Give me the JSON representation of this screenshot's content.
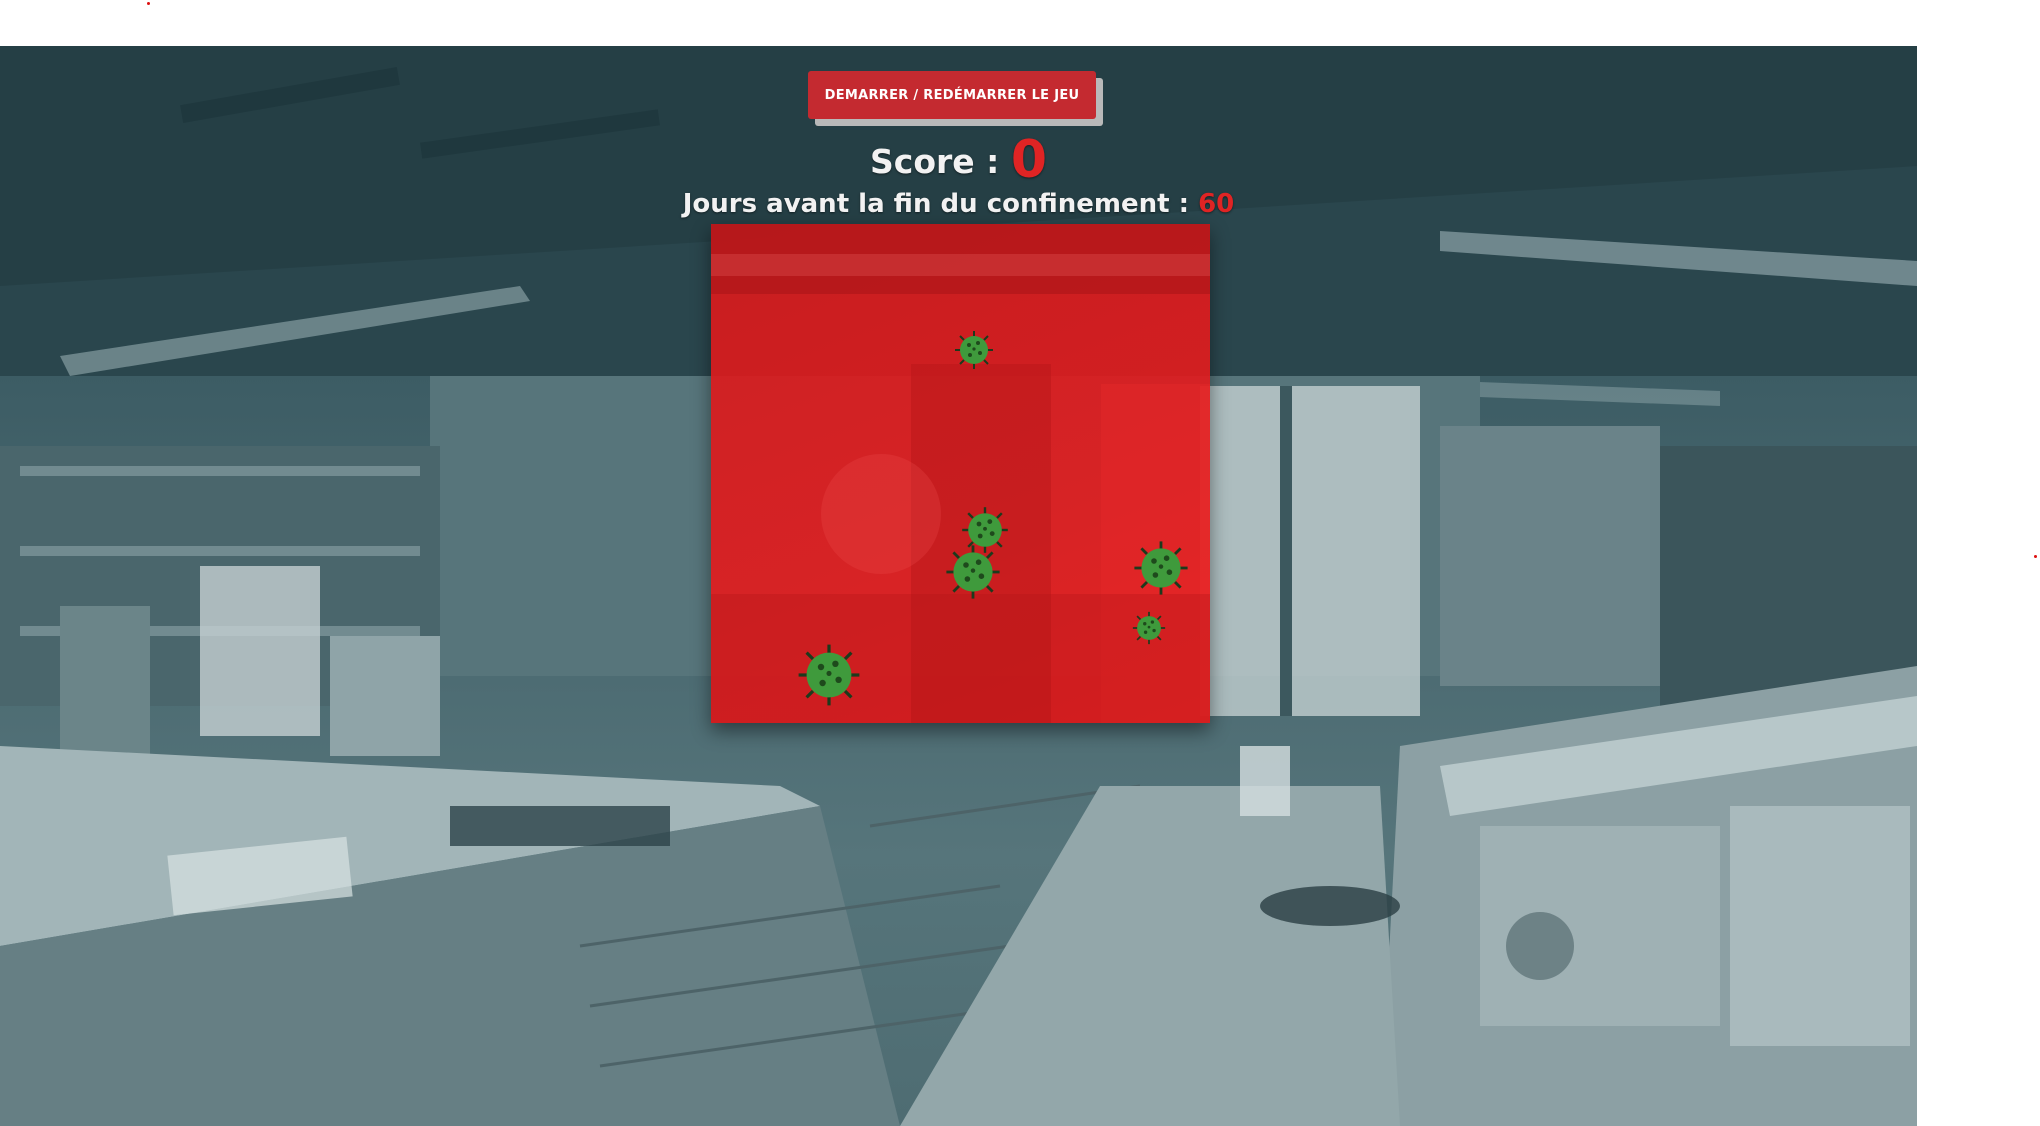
{
  "game": {
    "start_button_label": "DEMARRER / REDÉMARRER LE JEU",
    "score_label": "Score : ",
    "score_value": "0",
    "days_label": "Jours avant la fin du confinement : ",
    "days_value": "60"
  },
  "colors": {
    "accent": "#c42a30",
    "score_red": "#e02424",
    "board_red": "#d81c1e",
    "virus_green": "#3f9a3c"
  },
  "viruses": [
    {
      "name": "virus-1",
      "icon": "virus-icon"
    },
    {
      "name": "virus-2",
      "icon": "virus-icon"
    },
    {
      "name": "virus-3",
      "icon": "virus-icon"
    },
    {
      "name": "virus-4",
      "icon": "virus-icon"
    },
    {
      "name": "virus-5",
      "icon": "virus-icon"
    },
    {
      "name": "virus-6",
      "icon": "virus-icon"
    }
  ]
}
